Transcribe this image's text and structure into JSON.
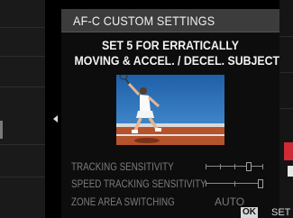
{
  "dialog": {
    "title": "AF-C CUSTOM SETTINGS",
    "description_line1": "SET 5 FOR ERRATICALLY",
    "description_line2": "MOVING & ACCEL. / DECEL. SUBJECT",
    "illustration": "tennis-player-photo"
  },
  "settings": [
    {
      "label": "TRACKING SENSITIVITY",
      "control": "slider",
      "level": 3,
      "max": 4
    },
    {
      "label": "SPEED TRACKING SENSITIVITY",
      "control": "slider",
      "level": 2,
      "max": 2
    },
    {
      "label": "ZONE AREA SWITCHING",
      "value": "AUTO"
    }
  ],
  "footer": {
    "ok_key": "OK",
    "ok_action": "SET"
  },
  "colors": {
    "title_bar": "#3c3c3c",
    "label_dim": "#7c7c7c",
    "accent_red": "#d02a36"
  }
}
